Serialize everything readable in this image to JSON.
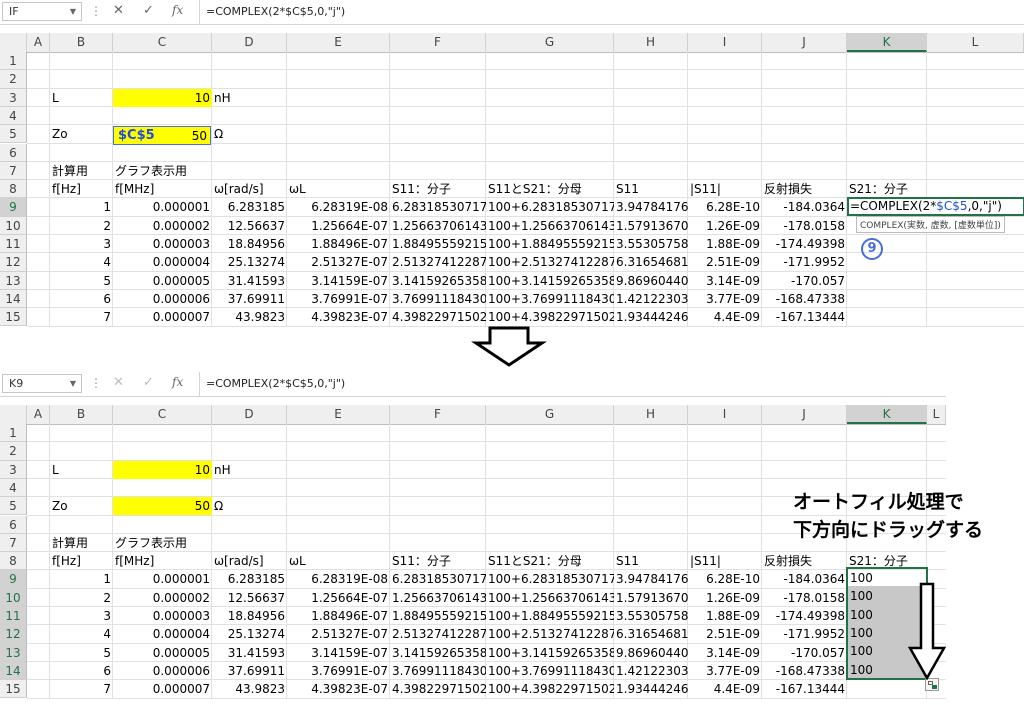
{
  "columns": [
    "A",
    "B",
    "C",
    "D",
    "E",
    "F",
    "G",
    "H",
    "I",
    "J",
    "K",
    "L"
  ],
  "rows": [
    "1",
    "2",
    "3",
    "4",
    "5",
    "6",
    "7",
    "8",
    "9",
    "10",
    "11",
    "12",
    "13",
    "14",
    "15"
  ],
  "top": {
    "name_box": "IF",
    "formula_prefix": "=COMPLEX(2*",
    "formula_ref": "$C$5",
    "formula_suffix": ",0,\"j\")",
    "formula_full": "=COMPLEX(2*$C$5,0,\"j\")",
    "c5_edit_ref": "$C$5",
    "tooltip": "COMPLEX(実数, 虚数, [虚数単位])",
    "badge": "9"
  },
  "bottom": {
    "name_box": "K9",
    "formula": "=COMPLEX(2*$C$5,0,\"j\")",
    "note_line1": "オートフィル処理で",
    "note_line2": "下方向にドラッグする",
    "fill_values": [
      "100",
      "100",
      "100",
      "100",
      "100",
      "100"
    ]
  },
  "sheet": {
    "b3": "L",
    "c3": "10",
    "d3": "nH",
    "b5": "Zo",
    "c5": "50",
    "d5": "Ω",
    "b7": "計算用",
    "c7": "グラフ表示用",
    "headers": [
      "f[Hz]",
      "f[MHz]",
      "ω[rad/s]",
      "ωL",
      "S11：分子",
      "S11とS21：分母",
      "S11",
      "|S11|",
      "反射損失",
      "S21：分子"
    ],
    "data": [
      [
        "1",
        "0.000001",
        "6.283185",
        "6.28319E-08",
        "6.28318530717",
        "100+6.28318530717",
        "3.94784176",
        "6.28E-10",
        "-184.0364"
      ],
      [
        "2",
        "0.000002",
        "12.56637",
        "1.25664E-07",
        "1.25663706143",
        "100+1.25663706143",
        "1.57913670",
        "1.26E-09",
        "-178.0158"
      ],
      [
        "3",
        "0.000003",
        "18.84956",
        "1.88496E-07",
        "1.88495559215",
        "100+1.88495559215",
        "3.55305758",
        "1.88E-09",
        "-174.49398"
      ],
      [
        "4",
        "0.000004",
        "25.13274",
        "2.51327E-07",
        "2.51327412287",
        "100+2.51327412287",
        "6.31654681",
        "2.51E-09",
        "-171.9952"
      ],
      [
        "5",
        "0.000005",
        "31.41593",
        "3.14159E-07",
        "3.14159265358",
        "100+3.14159265358",
        "9.86960440",
        "3.14E-09",
        "-170.057"
      ],
      [
        "6",
        "0.000006",
        "37.69911",
        "3.76991E-07",
        "3.76991118430",
        "100+3.76991118430",
        "1.42122303",
        "3.77E-09",
        "-168.47338"
      ],
      [
        "7",
        "0.000007",
        "43.9823",
        "4.39823E-07",
        "4.39822971502",
        "100+4.39822971502",
        "1.93444246",
        "4.4E-09",
        "-167.13444"
      ]
    ]
  },
  "colors": {
    "accent": "#217346",
    "highlight": "#ffff00",
    "ref_blue": "#1f4fd8",
    "badge": "#4a6fd8"
  }
}
